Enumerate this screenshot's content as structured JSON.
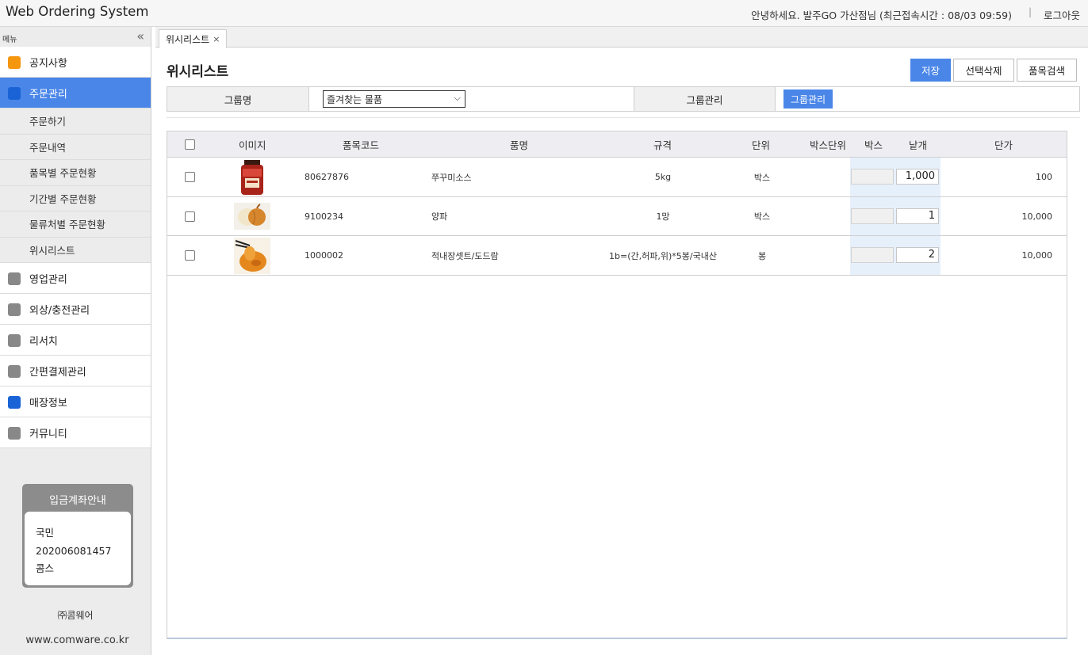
{
  "header": {
    "app_title": "Web Ordering System",
    "user_info": "안녕하세요. 발주GO 가산점님 (최근접속시간 : 08/03 09:59)",
    "separator": "|",
    "logout": "로그아웃"
  },
  "sidebar": {
    "menu_label": "메뉴",
    "collapse_glyph": "«",
    "items": [
      {
        "label": "공지사항",
        "color": "#f5960f"
      },
      {
        "label": "주문관리",
        "color": "#1a63d6",
        "active": true
      },
      {
        "label": "영업관리",
        "color": "#888888"
      },
      {
        "label": "외상/충전관리",
        "color": "#888888"
      },
      {
        "label": "리서치",
        "color": "#888888"
      },
      {
        "label": "간편결제관리",
        "color": "#888888"
      },
      {
        "label": "매장정보",
        "color": "#1a63d6"
      },
      {
        "label": "커뮤니티",
        "color": "#888888"
      }
    ],
    "sub_items": [
      "주문하기",
      "주문내역",
      "품목별 주문현황",
      "기간별 주문현황",
      "물류처별 주문현황",
      "위시리스트"
    ],
    "account_box": {
      "title": "입금계좌안내",
      "bank": "국민",
      "number": "202006081457",
      "holder": "콤스"
    },
    "company": "㈜콤웨어",
    "website": "www.comware.co.kr"
  },
  "tabs": [
    {
      "label": "위시리스트",
      "close": "×"
    }
  ],
  "page": {
    "title": "위시리스트",
    "buttons": {
      "save": "저장",
      "delete_selected": "선택삭제",
      "item_search": "품목검색"
    }
  },
  "filter": {
    "group_name_label": "그룹명",
    "group_select_value": "즐겨찾는 물품",
    "group_manage_label": "그룹관리",
    "group_manage_button": "그룹관리"
  },
  "table": {
    "columns": [
      "이미지",
      "품목코드",
      "품명",
      "규격",
      "단위",
      "박스단위",
      "박스",
      "낱개",
      "단가"
    ],
    "rows": [
      {
        "code": "80627876",
        "name": "쭈꾸미소스",
        "spec": "5kg",
        "unit": "박스",
        "box_unit": "",
        "box": "",
        "qty": "1,000",
        "price": "100",
        "image": "sauce-jar"
      },
      {
        "code": "9100234",
        "name": "양파",
        "spec": "1망",
        "unit": "박스",
        "box_unit": "",
        "box": "",
        "qty": "1",
        "price": "10,000",
        "image": "onion"
      },
      {
        "code": "1000002",
        "name": "적내장셋트/도드람",
        "spec": "1b=(간,허파,위)*5봉/국내산",
        "unit": "봉",
        "box_unit": "",
        "box": "",
        "qty": "2",
        "price": "10,000",
        "image": "organ-meat"
      }
    ]
  },
  "colors": {
    "accent": "#4a86e8",
    "active_menu": "#4a86e8",
    "qty_band": "#e6f0fb"
  }
}
